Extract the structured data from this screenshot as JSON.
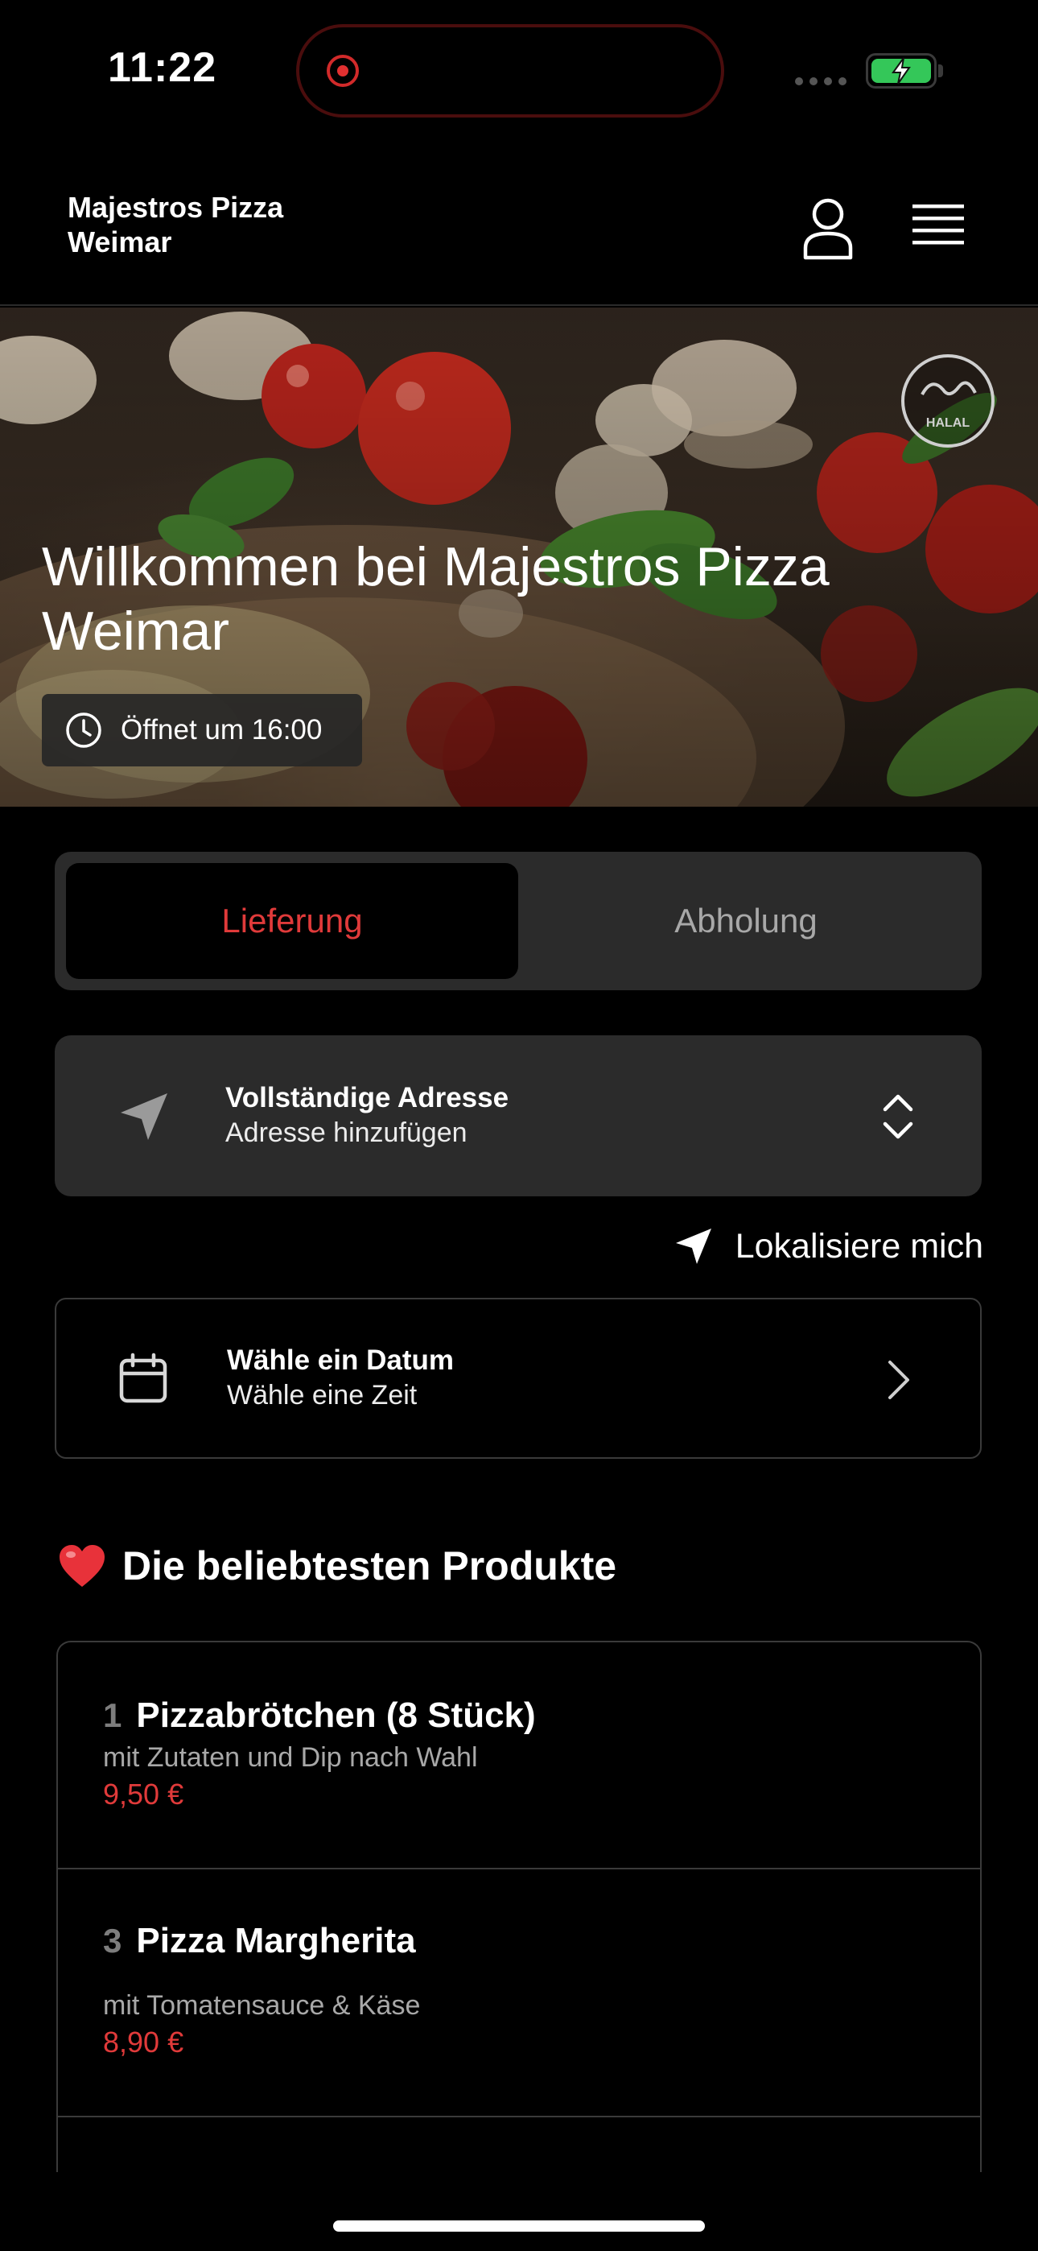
{
  "status_bar": {
    "time": "11:22"
  },
  "header": {
    "brand_line1": "Majestros Pizza",
    "brand_line2": "Weimar",
    "icons": [
      "user-icon",
      "menu-icon"
    ]
  },
  "hero": {
    "title": "Willkommen bei Majestros Pizza Weimar",
    "opening_hours": "Öffnet um 16:00",
    "halal_label": "HALAL"
  },
  "order_mode": {
    "options": [
      "Lieferung",
      "Abholung"
    ],
    "selected": "Lieferung"
  },
  "address": {
    "title": "Vollständige Adresse",
    "subtitle": "Adresse hinzufügen"
  },
  "locate": {
    "label": "Lokalisiere mich"
  },
  "schedule": {
    "title": "Wähle ein Datum",
    "subtitle": "Wähle eine Zeit"
  },
  "popular": {
    "section_title": "Die beliebtesten Produkte",
    "products": [
      {
        "number": "1",
        "name": "Pizzabrötchen (8 Stück)",
        "description": "mit Zutaten und Dip nach Wahl",
        "price": "9,50 €"
      },
      {
        "number": "3",
        "name": "Pizza Margherita",
        "description": "mit Tomatensauce & Käse",
        "price": "8,90 €"
      }
    ]
  },
  "colors": {
    "accent": "#e03a3a",
    "background": "#000000",
    "card": "#2b2b2b",
    "muted_text": "#a8a8a8"
  }
}
